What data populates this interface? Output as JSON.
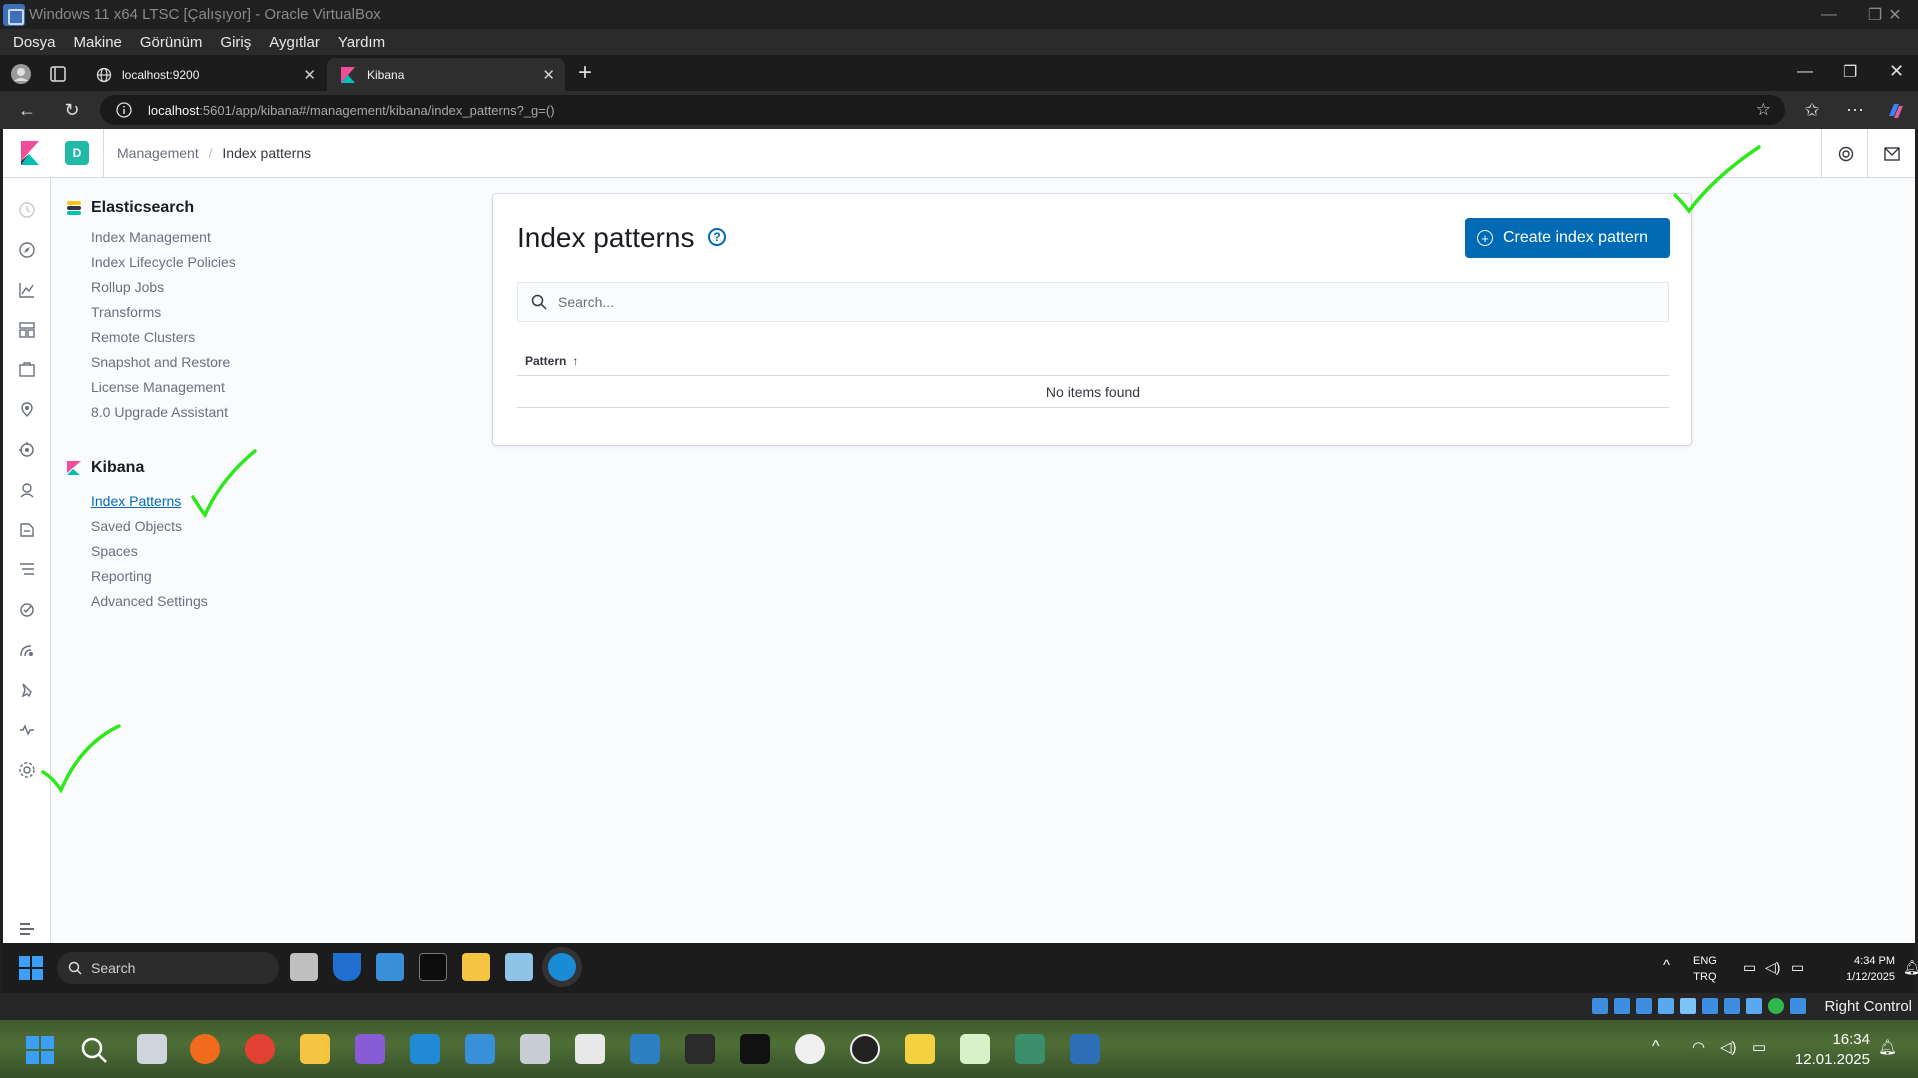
{
  "vbox": {
    "title": "Windows 11 x64 LTSC [Çalışıyor] - Oracle VirtualBox",
    "menu": [
      "Dosya",
      "Makine",
      "Görünüm",
      "Giriş",
      "Aygıtlar",
      "Yardım"
    ],
    "host_key": "Right Control"
  },
  "browser": {
    "tabs": [
      {
        "label": "localhost:9200",
        "active": false
      },
      {
        "label": "Kibana",
        "active": true
      }
    ],
    "url_host": "localhost",
    "url_rest": ":5601/app/kibana#/management/kibana/index_patterns?_g=()"
  },
  "kibana": {
    "space_initial": "D",
    "breadcrumb": {
      "parent": "Management",
      "sep": "/",
      "current": "Index patterns"
    },
    "nav": {
      "elasticsearch": {
        "title": "Elasticsearch",
        "links": [
          "Index Management",
          "Index Lifecycle Policies",
          "Rollup Jobs",
          "Transforms",
          "Remote Clusters",
          "Snapshot and Restore",
          "License Management",
          "8.0 Upgrade Assistant"
        ]
      },
      "kibana": {
        "title": "Kibana",
        "links": [
          "Index Patterns",
          "Saved Objects",
          "Spaces",
          "Reporting",
          "Advanced Settings"
        ],
        "active": "Index Patterns"
      }
    },
    "panel": {
      "title": "Index patterns",
      "help_icon": "?",
      "create_button": "Create index pattern",
      "search_placeholder": "Search...",
      "column_header": "Pattern",
      "sort_glyph": "↑",
      "empty_text": "No items found"
    }
  },
  "guest_taskbar": {
    "search_label": "Search",
    "lang": "ENG",
    "layout": "TRQ",
    "time": "4:34 PM",
    "date": "1/12/2025"
  },
  "host_taskbar": {
    "time": "16:34",
    "date": "12.01.2025"
  },
  "colors": {
    "kibana_blue": "#006bb4",
    "check_green": "#2ee81a",
    "space_avatar": "#23b9a7"
  }
}
